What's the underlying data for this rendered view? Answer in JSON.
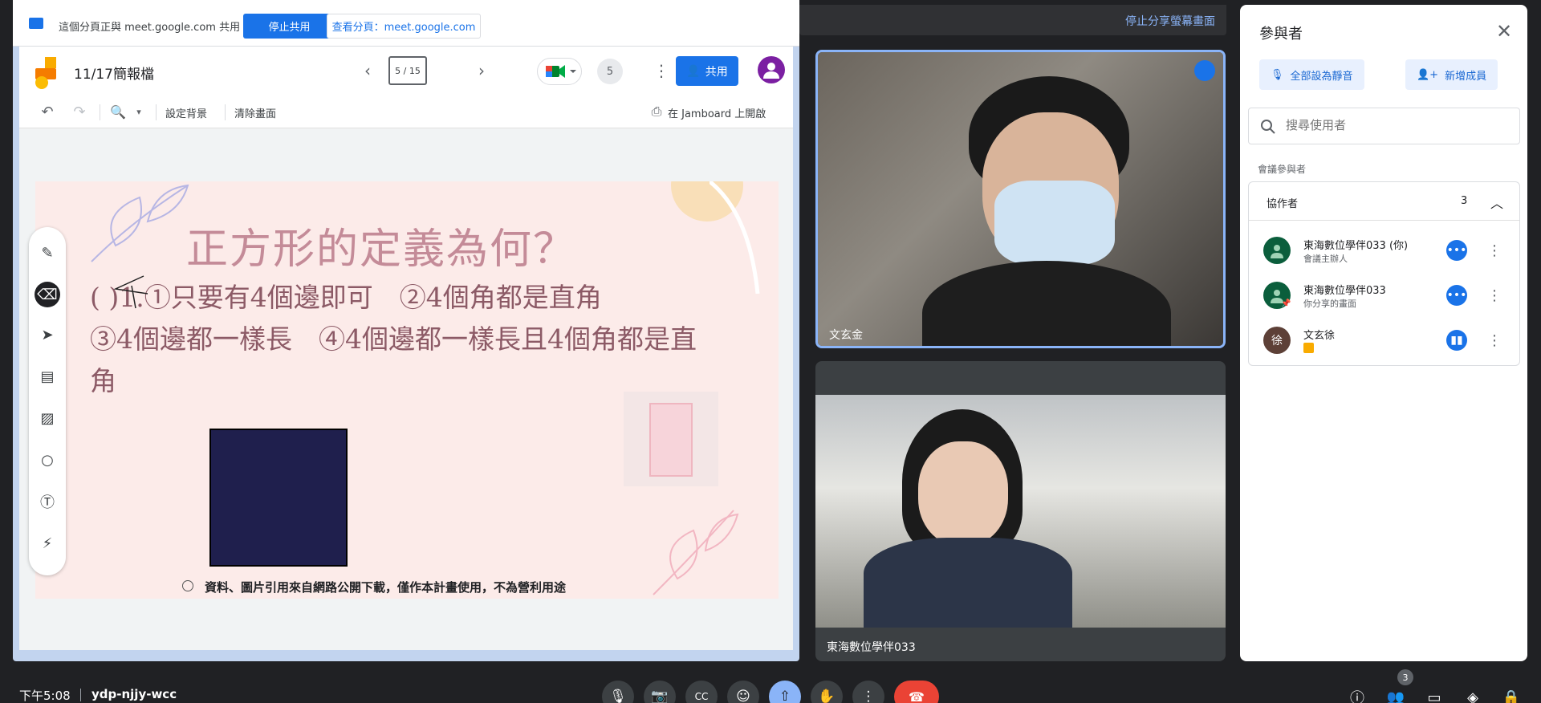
{
  "colors": {
    "accent": "#1a73e8",
    "link": "#8ab4f8",
    "end_call": "#ea4335",
    "bg": "#202124"
  },
  "top_strip": {
    "stop_sharing_label": "停止分享螢幕畫面"
  },
  "share_bar": {
    "message": "這個分頁正與 meet.google.com 共用",
    "stop_label": "停止共用",
    "view_label": "查看分頁：meet.google.com"
  },
  "jamboard": {
    "title": "11/17簡報檔",
    "frame_counter": "5 / 15",
    "participant_count": "5",
    "share_label": "共用",
    "toolbar": {
      "set_background": "設定背景",
      "clear_frame": "清除畫面",
      "open_in_jamboard": "在 Jamboard 上開啟"
    },
    "tools": [
      "pen-icon",
      "eraser-icon",
      "select-icon",
      "sticky-note-icon",
      "image-icon",
      "circle-icon",
      "text-box-icon",
      "laser-icon"
    ]
  },
  "slide": {
    "title": "正方形的定義為何？",
    "lines": [
      "(        )1.①只要有4個邊即可　②4個角都是直角",
      "③4個邊都一樣長　④4個邊都一樣長且4個角都是直",
      "角"
    ],
    "footer": "資料、圖片引用來自網路公開下載，僅作本計畫使用，不為營利用途"
  },
  "video_tiles": [
    {
      "name": "文玄金"
    },
    {
      "name": "東海數位學伴033"
    }
  ],
  "people_panel": {
    "title": "參與者",
    "mute_all_label": "全部設為靜音",
    "add_people_label": "新增成員",
    "search_placeholder": "搜尋使用者",
    "section_label": "會議參與者",
    "group": {
      "label": "協作者",
      "count": "3"
    },
    "participants": [
      {
        "name": "東海數位學伴033 (你)",
        "sub": "會議主辦人",
        "avatar_text": "",
        "avatar_color": "#0b5e3c"
      },
      {
        "name": "東海數位學伴033",
        "sub": "你分享的畫面",
        "avatar_text": "",
        "avatar_color": "#0b5e3c"
      },
      {
        "name": "文玄徐",
        "sub": "",
        "avatar_text": "徐",
        "avatar_color": "#5d4037"
      }
    ]
  },
  "bottom_bar": {
    "time": "下午5:08",
    "meeting_code": "ydp-njjy-wcc",
    "people_badge": "3"
  }
}
